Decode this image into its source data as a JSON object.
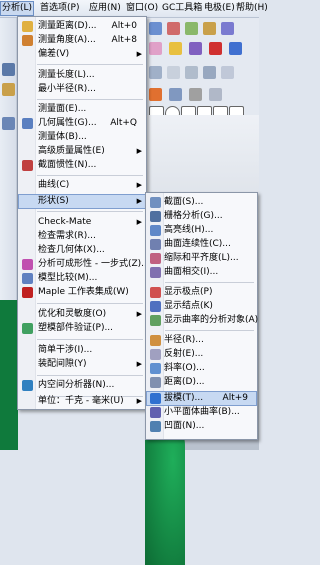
{
  "menubar": {
    "items": [
      {
        "label": "分析(L)"
      },
      {
        "label": "首选项(P)"
      },
      {
        "label": "应用(N)"
      },
      {
        "label": "窗口(O)"
      },
      {
        "label": "GC工具箱"
      },
      {
        "label": "电极(E)"
      },
      {
        "label": "帮助(H)"
      }
    ]
  },
  "menu_analysis": {
    "items": [
      {
        "label": "测量距离(D)...",
        "shortcut": "Alt+0",
        "icon": "ruler-icon"
      },
      {
        "label": "测量角度(A)...",
        "shortcut": "Alt+8",
        "icon": "angle-icon"
      },
      {
        "label": "偏差(V)"
      },
      {
        "label": "测量长度(L)..."
      },
      {
        "label": "最小半径(R)..."
      },
      {
        "label": "测量面(E)..."
      },
      {
        "label": "几何属性(G)...",
        "shortcut": "Alt+Q",
        "icon": "geometry-props-icon"
      },
      {
        "label": "测量体(B)..."
      },
      {
        "label": "高级质量属性(E)"
      },
      {
        "label": "截面惯性(N)...",
        "icon": "section-inertia-icon"
      },
      {
        "label": "曲线(C)"
      },
      {
        "label": "形状(S)"
      },
      {
        "label": "Check-Mate"
      },
      {
        "label": "检查需求(R)..."
      },
      {
        "label": "检查几何体(X)..."
      },
      {
        "label": "分析可成形性 - 一步式(Z)...",
        "icon": "formability-icon"
      },
      {
        "label": "模型比较(M)...",
        "icon": "model-compare-icon"
      },
      {
        "label": "Maple 工作表集成(W)",
        "icon": "maple-icon"
      },
      {
        "label": "优化和灵敏度(O)"
      },
      {
        "label": "塑模部件验证(P)...",
        "icon": "mold-validate-icon"
      },
      {
        "label": "简单干涉(I)..."
      },
      {
        "label": "装配间隙(Y)"
      },
      {
        "label": "内空间分析器(N)...",
        "icon": "inner-space-icon"
      },
      {
        "label": "单位：千克 - 毫米(U)"
      }
    ]
  },
  "menu_shape": {
    "items": [
      {
        "label": "截面(S)...",
        "icon": "section-icon"
      },
      {
        "label": "栅格分析(G)...",
        "icon": "grid-icon"
      },
      {
        "label": "高亮线(H)...",
        "icon": "highlight-lines-icon"
      },
      {
        "label": "曲面连续性(C)...",
        "icon": "surface-continuity-icon"
      },
      {
        "label": "缩际和平齐度(L)...",
        "icon": "gap-flush-icon"
      },
      {
        "label": "曲面相交(I)...",
        "icon": "surface-intersect-icon"
      },
      {
        "label": "显示极点(P)",
        "icon": "poles-icon"
      },
      {
        "label": "显示结点(K)",
        "icon": "knots-icon"
      },
      {
        "label": "显示曲率的分析对象(A)",
        "icon": "curvature-objects-icon"
      },
      {
        "label": "半径(R)...",
        "icon": "radius-icon"
      },
      {
        "label": "反射(E)...",
        "icon": "reflection-icon"
      },
      {
        "label": "斜率(O)...",
        "icon": "slope-icon"
      },
      {
        "label": "距离(D)...",
        "icon": "distance-icon"
      },
      {
        "label": "拔模(T)...",
        "shortcut": "Alt+9",
        "icon": "draft-icon"
      },
      {
        "label": "小平面体曲率(B)...",
        "icon": "facet-curvature-icon"
      },
      {
        "label": "凹面(N)...",
        "icon": "concave-icon"
      }
    ]
  },
  "colors": {
    "highlight": "#c7d9f2",
    "highlight_border": "#7f9ecf"
  }
}
